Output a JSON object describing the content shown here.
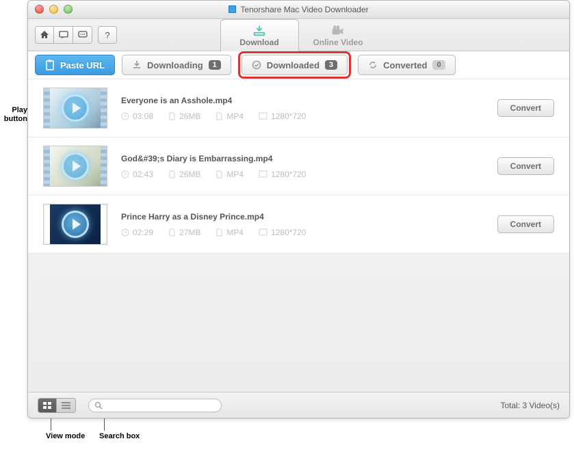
{
  "window": {
    "title": "Tenorshare Mac Video Downloader"
  },
  "bigtabs": {
    "download": "Download",
    "online_video": "Online Video"
  },
  "topbuttons": {
    "paste_url": "Paste URL",
    "downloading_label": "Downloading",
    "downloading_count": "1",
    "downloaded_label": "Downloaded",
    "downloaded_count": "3",
    "converted_label": "Converted",
    "converted_count": "0"
  },
  "videos": [
    {
      "title": "Everyone is an Asshole.mp4",
      "duration": "03:08",
      "size": "26MB",
      "format": "MP4",
      "resolution": "1280*720",
      "convert_label": "Convert"
    },
    {
      "title": "God&#39;s Diary is Embarrassing.mp4",
      "duration": "02:43",
      "size": "26MB",
      "format": "MP4",
      "resolution": "1280*720",
      "convert_label": "Convert"
    },
    {
      "title": "Prince Harry as a Disney Prince.mp4",
      "duration": "02:29",
      "size": "27MB",
      "format": "MP4",
      "resolution": "1280*720",
      "convert_label": "Convert"
    }
  ],
  "footer": {
    "total": "Total: 3 Video(s)"
  },
  "annotations": {
    "play_button": "Play\nbutton",
    "view_mode": "View mode",
    "search_box": "Search box"
  }
}
